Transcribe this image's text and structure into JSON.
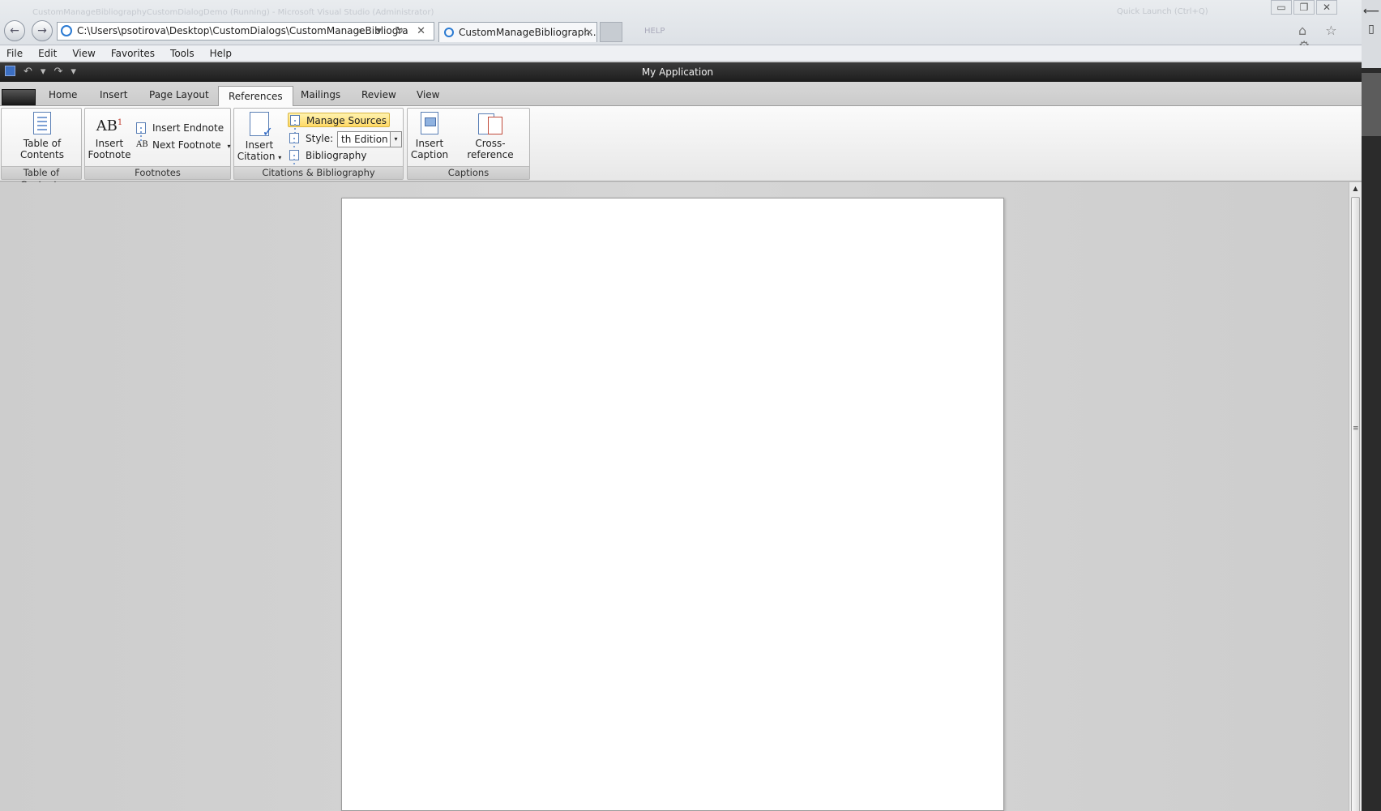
{
  "browser": {
    "address": "C:\\Users\\psotirova\\Desktop\\CustomDialogs\\CustomManageBibliogra",
    "tab_title": "CustomManageBibliograph...",
    "tab_close": "✕",
    "faint_title": "CustomManageBibliographyCustomDialogDemo (Running) - Microsoft Visual Studio (Administrator)",
    "faint_help": "HELP",
    "faint_quick_launch": "Quick Launch (Ctrl+Q)",
    "address_tools": "⌕ ▾ ↻ ✕",
    "window_buttons": [
      "▭",
      "❐",
      "✕"
    ],
    "fav_icons": "⌂ ☆ ⚙"
  },
  "menubar": {
    "items": [
      "File",
      "Edit",
      "View",
      "Favorites",
      "Tools",
      "Help"
    ]
  },
  "app": {
    "title": "My Application",
    "qat": {
      "undo": "↶",
      "undo_drop": "▾",
      "redo": "↷",
      "customize": "▾"
    }
  },
  "ribbon": {
    "tabs": {
      "home": "Home",
      "insert": "Insert",
      "page_layout": "Page Layout",
      "references": "References",
      "mailings": "Mailings",
      "review": "Review",
      "view": "View"
    },
    "groups": {
      "toc": {
        "label": "Table of Contents",
        "button": "Table of Contents"
      },
      "footnotes": {
        "label": "Footnotes",
        "insert_footnote": "Insert Footnote",
        "insert_endnote": "Insert Endnote",
        "next_footnote": "Next Footnote",
        "ab": "AB",
        "ab_sup": "1"
      },
      "citations": {
        "label": "Citations & Bibliography",
        "insert_citation": "Insert Citation",
        "manage_sources": "Manage Sources",
        "style_label": "Style:",
        "style_value": "th Edition",
        "bibliography": "Bibliography"
      },
      "captions": {
        "label": "Captions",
        "insert_caption": "Insert Caption",
        "cross_reference": "Cross-reference"
      }
    }
  },
  "colors": {
    "accent_highlight": "#ffd966",
    "app_titlebar": "#2a2a2a",
    "ribbon_background": "#f2f2f2"
  }
}
